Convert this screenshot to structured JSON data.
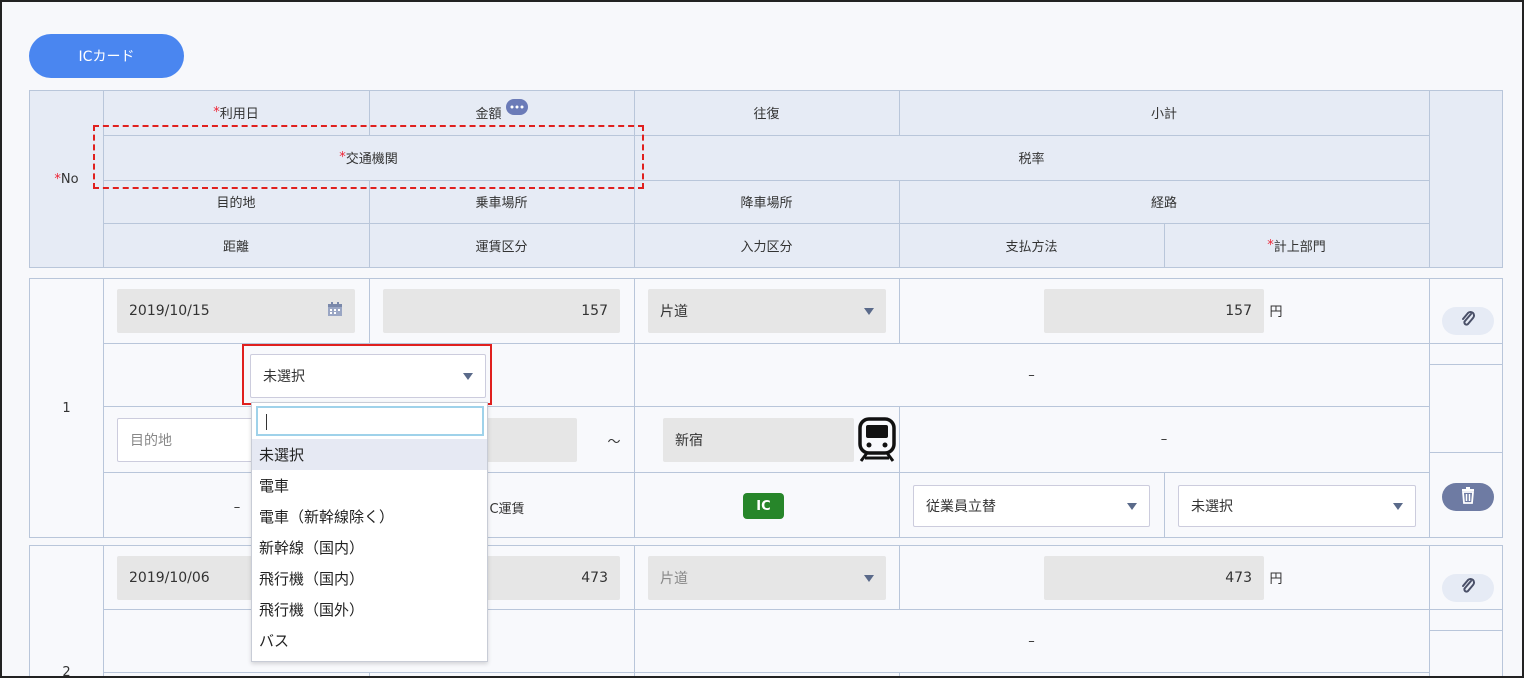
{
  "ic_card_button": "ICカード",
  "header": {
    "required_mark": "*",
    "no": "No",
    "row1": {
      "date": "利用日",
      "amount": "金額",
      "round_trip": "往復",
      "subtotal": "小計"
    },
    "row2": {
      "transport": "交通機関",
      "tax_rate": "税率"
    },
    "row3": {
      "destination": "目的地",
      "boarding": "乗車場所",
      "alighting": "降車場所",
      "route": "経路"
    },
    "row4": {
      "distance": "距離",
      "fare_type": "運賃区分",
      "input_type": "入力区分",
      "payment": "支払方法",
      "department": "計上部門"
    }
  },
  "rows": [
    {
      "no": "1",
      "date": "2019/10/15",
      "amount": "157",
      "trip": "片道",
      "subtotal": "157",
      "currency": "円",
      "transport_select": "未選択",
      "tax_rate": "–",
      "destination_placeholder": "目的地",
      "tilde": "～",
      "alighting": "新宿",
      "route": "–",
      "distance": "–",
      "fare_type_partial": "C運賃",
      "input_badge": "IC",
      "payment": "従業員立替",
      "department": "未選択"
    },
    {
      "no": "2",
      "date": "2019/10/06",
      "amount": "473",
      "trip": "片道",
      "subtotal": "473",
      "currency": "円",
      "tax_rate": "–"
    }
  ],
  "dropdown": {
    "search_value": "",
    "options": [
      "未選択",
      "電車",
      "電車（新幹線除く）",
      "新幹線（国内）",
      "飛行機（国内）",
      "飛行機（国外）",
      "バス"
    ],
    "selected_index": 0
  }
}
